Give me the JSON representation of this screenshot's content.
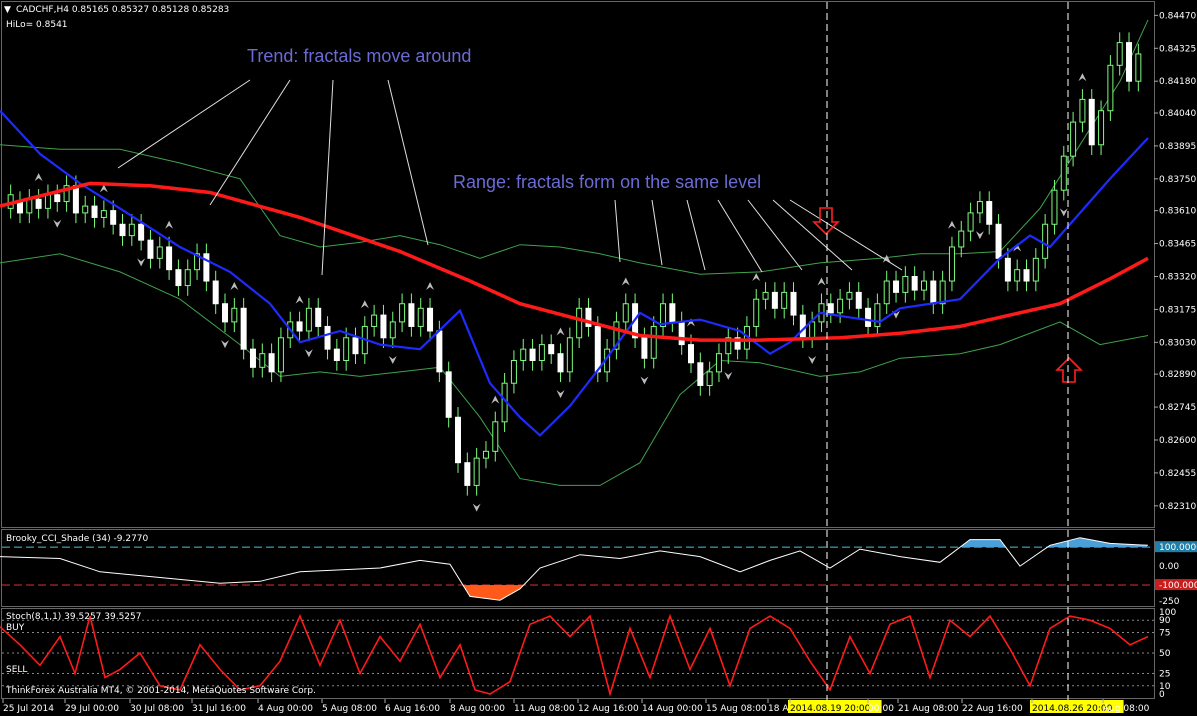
{
  "header": {
    "title": "CADCHF,H4  0.85165 0.85327 0.85128 0.85283",
    "hilo": "HiLo= 0.8541"
  },
  "annotations": {
    "trend": "Trend: fractals move around",
    "range": "Range: fractals form on the same level"
  },
  "cci": {
    "title": "Brooky_CCI_Shade (34) -9.2770",
    "levels": [
      "100.0000",
      "0.00",
      "-100.000",
      "-250"
    ]
  },
  "stoch": {
    "title": "Stoch(8,1,1) 39.5257 39.5257",
    "buy_label": "BUY",
    "sell_label": "SELL",
    "levels": [
      "100",
      "90",
      "75",
      "50",
      "25",
      "10",
      "0"
    ]
  },
  "footer": {
    "copyright": "ThinkForex Australia MT4, © 2001-2014, MetaQuotes Software Corp."
  },
  "chart_data": {
    "type": "candlestick",
    "symbol": "CADCHF",
    "timeframe": "H4",
    "price_ticks": [
      "0.84470",
      "0.84325",
      "0.84180",
      "0.84040",
      "0.83895",
      "0.83750",
      "0.83610",
      "0.83465",
      "0.83320",
      "0.83175",
      "0.83030",
      "0.82890",
      "0.82745",
      "0.82600",
      "0.82455",
      "0.82310"
    ],
    "ylim": [
      0.8223,
      0.8452
    ],
    "time_labels": [
      "25 Jul 2014",
      "29 Jul 00:00",
      "30 Jul 08:00",
      "31 Jul 16:00",
      "4 Aug 00:00",
      "5 Aug 08:00",
      "6 Aug 16:00",
      "8 Aug 00:00",
      "11 Aug 08:00",
      "12 Aug 16:00",
      "14 Aug 00:00",
      "15 Aug 08:00",
      "18 Aug",
      "2014.08.19 20:00",
      "00:00",
      "21 Aug 08:00",
      "22 Aug 16:00",
      "2014.08.26 20:00",
      "Aug 08:00"
    ],
    "current_price": "0.85283",
    "ma_red": [
      [
        0,
        0.8363
      ],
      [
        90,
        0.8373
      ],
      [
        150,
        0.8372
      ],
      [
        210,
        0.8369
      ],
      [
        300,
        0.8358
      ],
      [
        400,
        0.8343
      ],
      [
        470,
        0.833
      ],
      [
        520,
        0.832
      ],
      [
        580,
        0.8313
      ],
      [
        640,
        0.8306
      ],
      [
        700,
        0.8304
      ],
      [
        760,
        0.8304
      ],
      [
        840,
        0.8305
      ],
      [
        900,
        0.8307
      ],
      [
        960,
        0.831
      ],
      [
        1010,
        0.8315
      ],
      [
        1060,
        0.832
      ],
      [
        1110,
        0.8331
      ],
      [
        1148,
        0.834
      ]
    ],
    "ma_blue": [
      [
        0,
        0.8405
      ],
      [
        40,
        0.8386
      ],
      [
        80,
        0.8373
      ],
      [
        120,
        0.8362
      ],
      [
        180,
        0.8345
      ],
      [
        230,
        0.8334
      ],
      [
        270,
        0.832
      ],
      [
        300,
        0.8303
      ],
      [
        340,
        0.8308
      ],
      [
        380,
        0.8302
      ],
      [
        420,
        0.83
      ],
      [
        460,
        0.8317
      ],
      [
        490,
        0.8285
      ],
      [
        520,
        0.827
      ],
      [
        540,
        0.8262
      ],
      [
        570,
        0.8275
      ],
      [
        600,
        0.8292
      ],
      [
        620,
        0.8304
      ],
      [
        640,
        0.8316
      ],
      [
        660,
        0.8311
      ],
      [
        700,
        0.8313
      ],
      [
        740,
        0.8308
      ],
      [
        770,
        0.8298
      ],
      [
        790,
        0.8303
      ],
      [
        820,
        0.8316
      ],
      [
        850,
        0.8314
      ],
      [
        880,
        0.8312
      ],
      [
        900,
        0.8318
      ],
      [
        960,
        0.8322
      ],
      [
        1000,
        0.834
      ],
      [
        1030,
        0.835
      ],
      [
        1050,
        0.8345
      ],
      [
        1080,
        0.836
      ],
      [
        1110,
        0.8375
      ],
      [
        1148,
        0.8393
      ]
    ],
    "bb_upper": [
      [
        0,
        0.839
      ],
      [
        60,
        0.8388
      ],
      [
        120,
        0.8388
      ],
      [
        180,
        0.8382
      ],
      [
        240,
        0.8375
      ],
      [
        280,
        0.835
      ],
      [
        320,
        0.8345
      ],
      [
        360,
        0.8347
      ],
      [
        400,
        0.835
      ],
      [
        440,
        0.8346
      ],
      [
        480,
        0.834
      ],
      [
        520,
        0.8346
      ],
      [
        560,
        0.8345
      ],
      [
        600,
        0.8342
      ],
      [
        640,
        0.8338
      ],
      [
        700,
        0.8333
      ],
      [
        760,
        0.8334
      ],
      [
        820,
        0.8338
      ],
      [
        880,
        0.834
      ],
      [
        920,
        0.8342
      ],
      [
        960,
        0.8342
      ],
      [
        1000,
        0.8343
      ],
      [
        1040,
        0.8362
      ],
      [
        1080,
        0.839
      ],
      [
        1120,
        0.8418
      ],
      [
        1148,
        0.8445
      ]
    ],
    "bb_lower": [
      [
        0,
        0.8338
      ],
      [
        60,
        0.8342
      ],
      [
        120,
        0.8334
      ],
      [
        180,
        0.8322
      ],
      [
        240,
        0.8302
      ],
      [
        280,
        0.8288
      ],
      [
        320,
        0.829
      ],
      [
        360,
        0.8288
      ],
      [
        400,
        0.829
      ],
      [
        440,
        0.8292
      ],
      [
        480,
        0.827
      ],
      [
        520,
        0.8243
      ],
      [
        560,
        0.824
      ],
      [
        600,
        0.824
      ],
      [
        640,
        0.825
      ],
      [
        680,
        0.828
      ],
      [
        720,
        0.8295
      ],
      [
        760,
        0.8294
      ],
      [
        820,
        0.8288
      ],
      [
        860,
        0.829
      ],
      [
        900,
        0.8296
      ],
      [
        960,
        0.8298
      ],
      [
        1000,
        0.8302
      ],
      [
        1060,
        0.8312
      ],
      [
        1100,
        0.8302
      ],
      [
        1148,
        0.8306
      ]
    ],
    "candles": [
      [
        0.8362,
        0.8368
      ],
      [
        0.8365,
        0.836
      ],
      [
        0.836,
        0.8366
      ],
      [
        0.8366,
        0.8362
      ],
      [
        0.8362,
        0.8368
      ],
      [
        0.8368,
        0.8365
      ],
      [
        0.8365,
        0.8372
      ],
      [
        0.8372,
        0.836
      ],
      [
        0.836,
        0.8363
      ],
      [
        0.8363,
        0.8358
      ],
      [
        0.8358,
        0.8361
      ],
      [
        0.8361,
        0.8355
      ],
      [
        0.8355,
        0.835
      ],
      [
        0.835,
        0.8355
      ],
      [
        0.8355,
        0.8348
      ],
      [
        0.8348,
        0.834
      ],
      [
        0.834,
        0.8345
      ],
      [
        0.8345,
        0.8335
      ],
      [
        0.8335,
        0.8328
      ],
      [
        0.8328,
        0.8335
      ],
      [
        0.8335,
        0.8342
      ],
      [
        0.8342,
        0.833
      ],
      [
        0.833,
        0.832
      ],
      [
        0.832,
        0.8312
      ],
      [
        0.8312,
        0.8318
      ],
      [
        0.8318,
        0.83
      ],
      [
        0.83,
        0.8292
      ],
      [
        0.8292,
        0.8298
      ],
      [
        0.8298,
        0.829
      ],
      [
        0.829,
        0.8305
      ],
      [
        0.8305,
        0.8312
      ],
      [
        0.8312,
        0.8308
      ],
      [
        0.8308,
        0.8318
      ],
      [
        0.8318,
        0.831
      ],
      [
        0.831,
        0.83
      ],
      [
        0.83,
        0.8295
      ],
      [
        0.8295,
        0.8305
      ],
      [
        0.8305,
        0.8298
      ],
      [
        0.8298,
        0.831
      ],
      [
        0.831,
        0.8315
      ],
      [
        0.8315,
        0.8305
      ],
      [
        0.8305,
        0.8312
      ],
      [
        0.8312,
        0.832
      ],
      [
        0.832,
        0.831
      ],
      [
        0.831,
        0.8318
      ],
      [
        0.8318,
        0.8308
      ],
      [
        0.8308,
        0.829
      ],
      [
        0.829,
        0.827
      ],
      [
        0.827,
        0.825
      ],
      [
        0.825,
        0.824
      ],
      [
        0.824,
        0.8252
      ],
      [
        0.8252,
        0.8255
      ],
      [
        0.8255,
        0.8268
      ],
      [
        0.8268,
        0.8285
      ],
      [
        0.8285,
        0.8295
      ],
      [
        0.8295,
        0.83
      ],
      [
        0.83,
        0.8295
      ],
      [
        0.8295,
        0.8302
      ],
      [
        0.8302,
        0.8298
      ],
      [
        0.8298,
        0.829
      ],
      [
        0.829,
        0.8305
      ],
      [
        0.8305,
        0.8318
      ],
      [
        0.8318,
        0.831
      ],
      [
        0.831,
        0.829
      ],
      [
        0.829,
        0.83
      ],
      [
        0.83,
        0.8312
      ],
      [
        0.8312,
        0.832
      ],
      [
        0.832,
        0.8305
      ],
      [
        0.8305,
        0.8296
      ],
      [
        0.8296,
        0.831
      ],
      [
        0.831,
        0.832
      ],
      [
        0.832,
        0.8312
      ],
      [
        0.8312,
        0.8302
      ],
      [
        0.8302,
        0.8294
      ],
      [
        0.8294,
        0.8284
      ],
      [
        0.8284,
        0.829
      ],
      [
        0.829,
        0.8298
      ],
      [
        0.8298,
        0.8305
      ],
      [
        0.8305,
        0.83
      ],
      [
        0.83,
        0.831
      ],
      [
        0.831,
        0.8322
      ],
      [
        0.8322,
        0.8325
      ],
      [
        0.8325,
        0.8318
      ],
      [
        0.8318,
        0.8325
      ],
      [
        0.8325,
        0.8315
      ],
      [
        0.8315,
        0.8305
      ],
      [
        0.8305,
        0.8312
      ],
      [
        0.8312,
        0.832
      ],
      [
        0.832,
        0.8316
      ],
      [
        0.8316,
        0.8322
      ],
      [
        0.8322,
        0.8325
      ],
      [
        0.8325,
        0.8318
      ],
      [
        0.8318,
        0.831
      ],
      [
        0.831,
        0.832
      ],
      [
        0.832,
        0.833
      ],
      [
        0.833,
        0.8325
      ],
      [
        0.8325,
        0.8332
      ],
      [
        0.8332,
        0.8326
      ],
      [
        0.8326,
        0.833
      ],
      [
        0.833,
        0.832
      ],
      [
        0.832,
        0.833
      ],
      [
        0.833,
        0.8345
      ],
      [
        0.8345,
        0.8352
      ],
      [
        0.8352,
        0.836
      ],
      [
        0.836,
        0.8365
      ],
      [
        0.8365,
        0.8355
      ],
      [
        0.8355,
        0.834
      ],
      [
        0.834,
        0.833
      ],
      [
        0.833,
        0.8335
      ],
      [
        0.8335,
        0.833
      ],
      [
        0.833,
        0.834
      ],
      [
        0.834,
        0.8355
      ],
      [
        0.8355,
        0.837
      ],
      [
        0.837,
        0.8385
      ],
      [
        0.8385,
        0.84
      ],
      [
        0.84,
        0.841
      ],
      [
        0.841,
        0.839
      ],
      [
        0.839,
        0.8405
      ],
      [
        0.8405,
        0.8425
      ],
      [
        0.8425,
        0.8435
      ],
      [
        0.8435,
        0.8418
      ],
      [
        0.8418,
        0.843
      ]
    ]
  },
  "cci_data": [
    [
      0,
      0.5
    ],
    [
      60,
      0.4
    ],
    [
      100,
      -0.3
    ],
    [
      160,
      -0.6
    ],
    [
      220,
      -0.9
    ],
    [
      260,
      -0.8
    ],
    [
      300,
      -0.3
    ],
    [
      340,
      -0.2
    ],
    [
      380,
      -0.1
    ],
    [
      420,
      0.3
    ],
    [
      450,
      0.1
    ],
    [
      470,
      -1.6
    ],
    [
      500,
      -1.8
    ],
    [
      520,
      -1.2
    ],
    [
      540,
      -0.1
    ],
    [
      580,
      0.6
    ],
    [
      620,
      0.4
    ],
    [
      660,
      0.8
    ],
    [
      700,
      0.5
    ],
    [
      740,
      -0.3
    ],
    [
      770,
      0.3
    ],
    [
      800,
      0.8
    ],
    [
      830,
      -0.1
    ],
    [
      860,
      0.9
    ],
    [
      900,
      0.5
    ],
    [
      940,
      0.2
    ],
    [
      970,
      1.4
    ],
    [
      1000,
      1.4
    ],
    [
      1020,
      0.0
    ],
    [
      1050,
      1.1
    ],
    [
      1080,
      1.5
    ],
    [
      1110,
      1.2
    ],
    [
      1148,
      1.1
    ]
  ],
  "stoch_data": [
    [
      0,
      82
    ],
    [
      20,
      60
    ],
    [
      40,
      35
    ],
    [
      60,
      70
    ],
    [
      75,
      25
    ],
    [
      90,
      95
    ],
    [
      105,
      20
    ],
    [
      120,
      30
    ],
    [
      140,
      50
    ],
    [
      160,
      10
    ],
    [
      180,
      5
    ],
    [
      200,
      60
    ],
    [
      220,
      30
    ],
    [
      240,
      5
    ],
    [
      260,
      10
    ],
    [
      280,
      40
    ],
    [
      300,
      95
    ],
    [
      320,
      35
    ],
    [
      340,
      90
    ],
    [
      360,
      25
    ],
    [
      380,
      70
    ],
    [
      400,
      40
    ],
    [
      420,
      85
    ],
    [
      440,
      20
    ],
    [
      460,
      60
    ],
    [
      475,
      5
    ],
    [
      490,
      0
    ],
    [
      510,
      15
    ],
    [
      530,
      85
    ],
    [
      550,
      95
    ],
    [
      570,
      70
    ],
    [
      590,
      95
    ],
    [
      610,
      0
    ],
    [
      630,
      80
    ],
    [
      650,
      20
    ],
    [
      670,
      95
    ],
    [
      690,
      30
    ],
    [
      710,
      80
    ],
    [
      730,
      10
    ],
    [
      750,
      80
    ],
    [
      770,
      95
    ],
    [
      790,
      80
    ],
    [
      810,
      40
    ],
    [
      830,
      5
    ],
    [
      850,
      70
    ],
    [
      870,
      25
    ],
    [
      890,
      85
    ],
    [
      910,
      95
    ],
    [
      930,
      20
    ],
    [
      950,
      90
    ],
    [
      970,
      70
    ],
    [
      990,
      95
    ],
    [
      1010,
      55
    ],
    [
      1030,
      10
    ],
    [
      1050,
      80
    ],
    [
      1070,
      95
    ],
    [
      1090,
      90
    ],
    [
      1110,
      80
    ],
    [
      1130,
      60
    ],
    [
      1148,
      70
    ]
  ]
}
